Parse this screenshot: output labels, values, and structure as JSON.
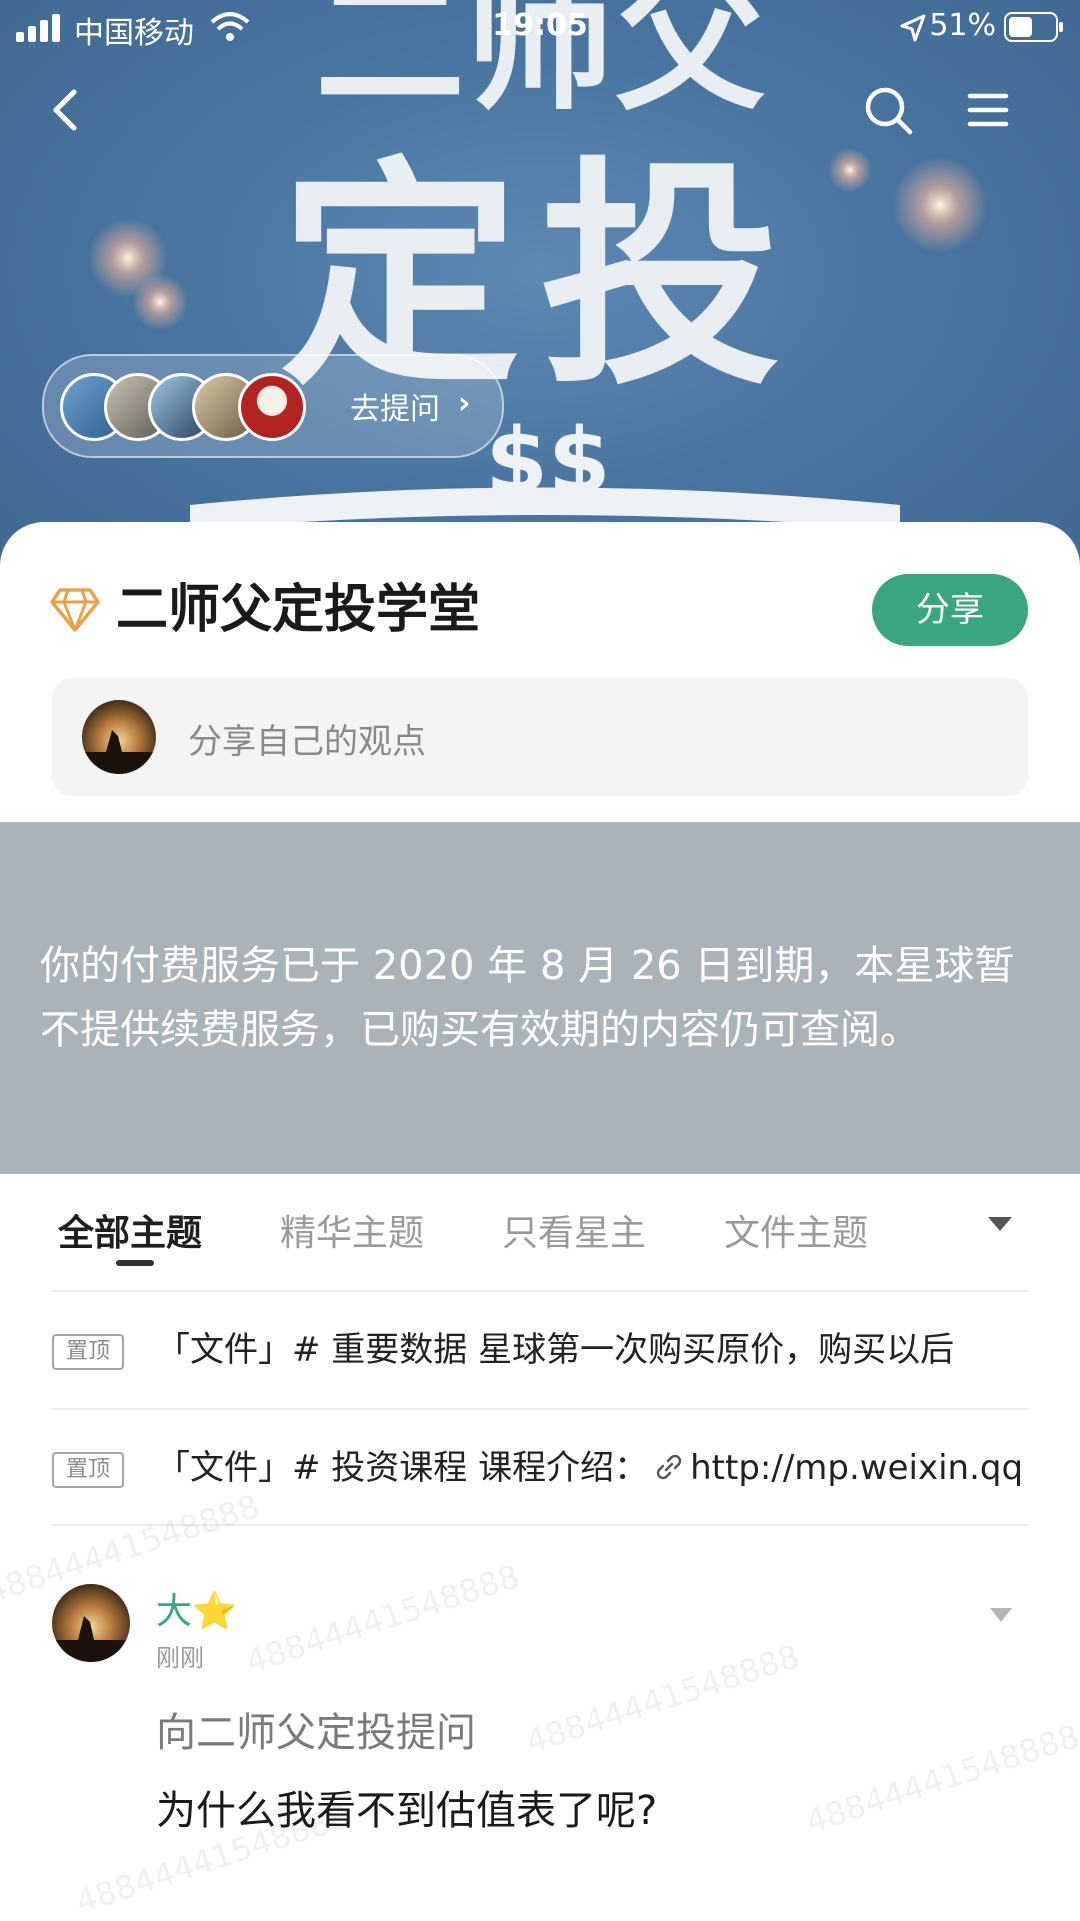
{
  "status_bar": {
    "carrier": "中国移动",
    "time": "19:05",
    "battery": "51%"
  },
  "hero": {
    "banner_text_top": "二师父",
    "banner_text_main": "定投",
    "banner_text_money": "$$",
    "ask_label": "去提问"
  },
  "group": {
    "title": "二师父定投学堂",
    "share_label": "分享"
  },
  "compose": {
    "placeholder": "分享自己的观点"
  },
  "notice": {
    "text": "你的付费服务已于 2020 年 8 月 26 日到期，本星球暂不提供续费服务，已购买有效期的内容仍可查阅。"
  },
  "tabs": [
    {
      "label": "全部主题"
    },
    {
      "label": "精华主题"
    },
    {
      "label": "只看星主"
    },
    {
      "label": "文件主题"
    }
  ],
  "pinned": [
    {
      "badge": "置顶",
      "text": "「文件」# 重要数据  星球第一次购买原价，购买以后"
    },
    {
      "badge": "置顶",
      "text_before_link": "「文件」# 投资课程  课程介绍：",
      "link": "http://mp.weixin.qq"
    }
  ],
  "post": {
    "author": "大⭐",
    "time": "刚刚",
    "question_to": "向二师父定投提问",
    "body": "为什么我看不到估值表了呢?"
  },
  "watermark": "48844441548888",
  "colors": {
    "accent": "#3aa680",
    "hero_blue": "#4a76a2",
    "notice_bg": "#aab4b8"
  }
}
